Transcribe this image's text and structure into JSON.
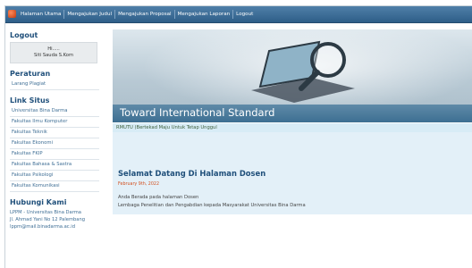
{
  "nav": {
    "items": [
      "Halaman Utama",
      "Mengajukan Judul",
      "Mengajukan Proposal",
      "Mengajukan Laporan",
      "Logout"
    ]
  },
  "sidebar": {
    "logout": {
      "heading": "Logout",
      "greeting": "Hi.....",
      "user": "Siti Sauda S.Kom"
    },
    "peraturan": {
      "heading": "Peraturan",
      "items": [
        "Larang Plagiat"
      ]
    },
    "link_situs": {
      "heading": "Link Situs",
      "items": [
        "Universitas Bina Darma",
        "Fakultas Ilmu Komputer",
        "Fakultas Teknik",
        "Fakultas Ekonomi",
        "Fakultas FKIP",
        "Fakultas Bahasa & Sastra",
        "Fakultas Psikologi",
        "Fakultas Komunikasi"
      ]
    },
    "hubungi": {
      "heading": "Hubungi Kami",
      "lines": [
        "LPPM - Universitas Bina Darma",
        "Jl. Ahmad Yani No 12 Palembang",
        "lppm@mail.binadarma.ac.id"
      ]
    }
  },
  "header": {
    "title": "Toward International Standard"
  },
  "tagline": "RMUTU (Bertekad Maju Untuk Tetap Unggul",
  "content": {
    "title": "Selamat Datang Di Halaman Dosen",
    "date": "February 9th, 2022",
    "line1": "Anda Berada pada halaman Dosen",
    "line2": "Lembaga Penelitian dan Pengabdian kepada Masyarakat Universitas Bina Darma"
  }
}
